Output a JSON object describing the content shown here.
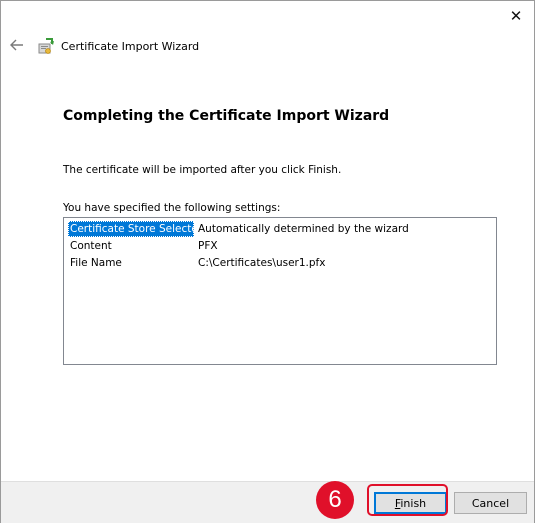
{
  "window": {
    "title": "Certificate Import Wizard",
    "close_glyph": "✕"
  },
  "page": {
    "heading": "Completing the Certificate Import Wizard",
    "info": "The certificate will be imported after you click Finish.",
    "settings_label": "You have specified the following settings:"
  },
  "settings": [
    {
      "key": "Certificate Store Selected",
      "value": "Automatically determined by the wizard",
      "selected": true
    },
    {
      "key": "Content",
      "value": "PFX",
      "selected": false
    },
    {
      "key": "File Name",
      "value": "C:\\Certificates\\user1.pfx",
      "selected": false
    }
  ],
  "buttons": {
    "finish_label": "Finish",
    "cancel_label": "Cancel"
  },
  "annotation": {
    "step_number": "6",
    "color": "#e0102a"
  },
  "icons": {
    "back": "arrow-left-icon",
    "app": "certificate-wizard-icon",
    "close": "close-icon"
  },
  "colors": {
    "selection": "#0078d7",
    "footer": "#f0f0f0"
  }
}
